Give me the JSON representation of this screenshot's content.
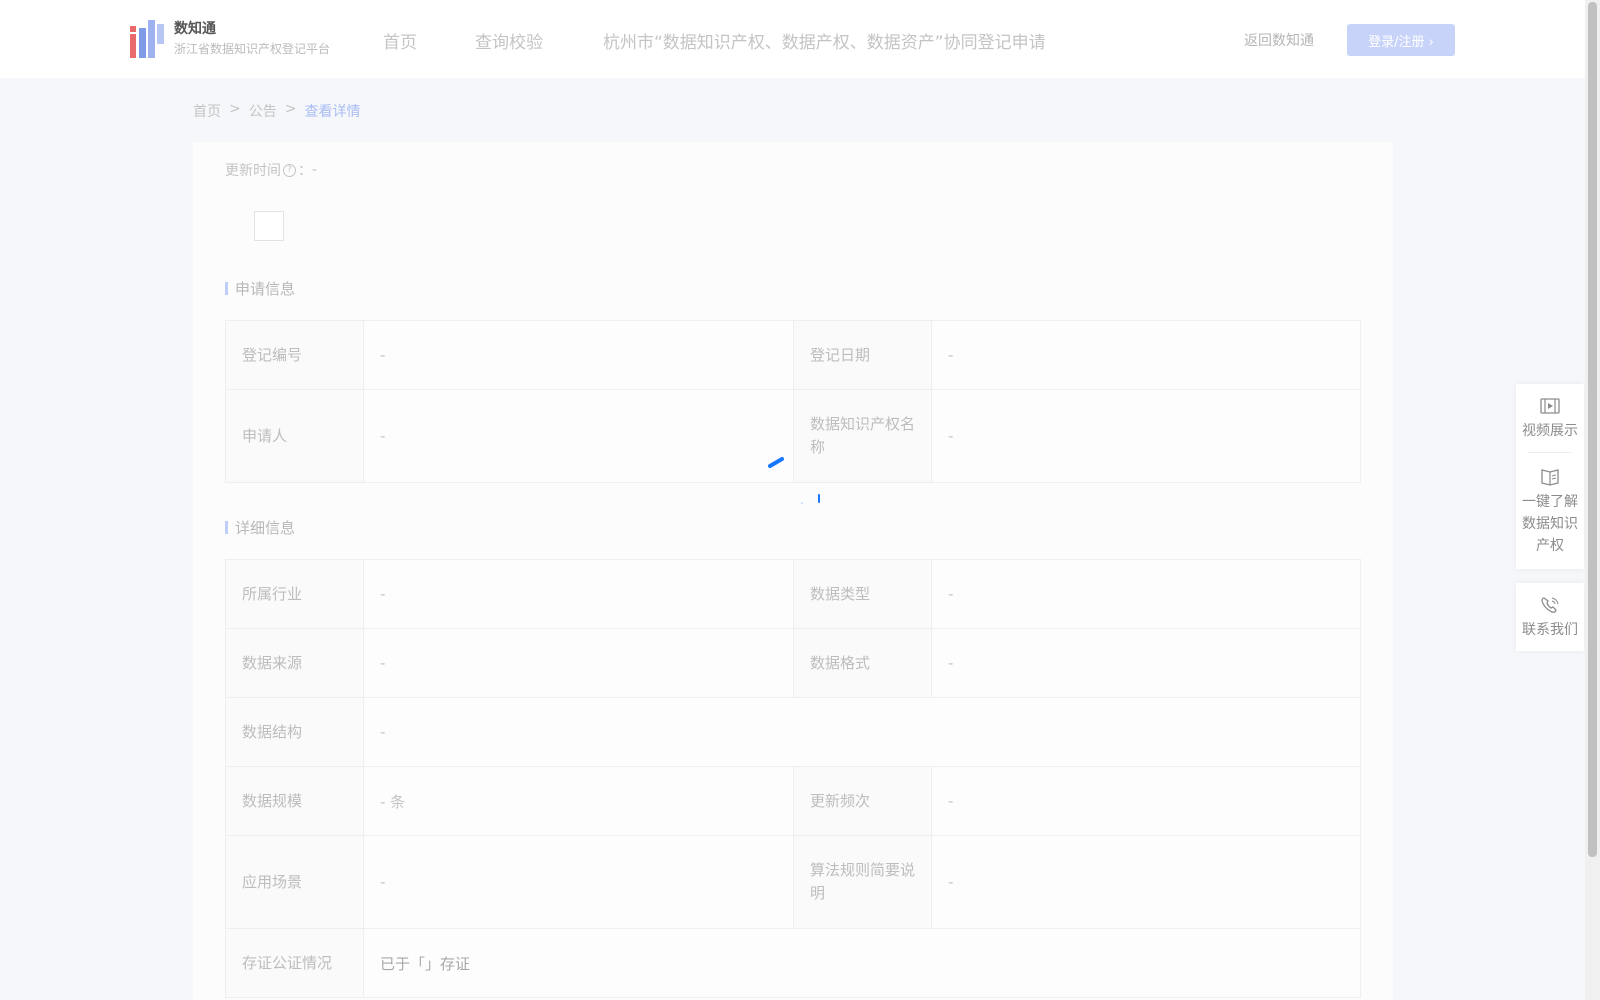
{
  "header": {
    "logo_title": "数知通",
    "logo_subtitle": "浙江省数据知识产权登记平台",
    "nav": [
      "首页",
      "查询校验",
      "杭州市“数据知识产权、数据产权、数据资产”协同登记申请"
    ],
    "return_link": "返回数知通",
    "login_label": "登录/注册 ›"
  },
  "breadcrumb": {
    "home": "首页",
    "sep1": ">",
    "notice": "公告",
    "sep2": ">",
    "current": "查看详情"
  },
  "update_time": {
    "label": "更新时间",
    "help": "?",
    "colon": "：",
    "value": "-"
  },
  "sections": {
    "apply_title": "申请信息",
    "detail_title": "详细信息"
  },
  "apply_info": {
    "reg_no_label": "登记编号",
    "reg_no_value": "-",
    "reg_date_label": "登记日期",
    "reg_date_value": "-",
    "applicant_label": "申请人",
    "applicant_value": "-",
    "ip_name_label": "数据知识产权名称",
    "ip_name_value": "-"
  },
  "detail_info": {
    "industry_label": "所属行业",
    "industry_value": "-",
    "data_type_label": "数据类型",
    "data_type_value": "-",
    "source_label": "数据来源",
    "source_value": "-",
    "format_label": "数据格式",
    "format_value": "-",
    "structure_label": "数据结构",
    "structure_value": "-",
    "scale_label": "数据规模",
    "scale_value": "- 条",
    "frequency_label": "更新频次",
    "frequency_value": "-",
    "scenario_label": "应用场景",
    "scenario_value": "-",
    "algorithm_label": "算法规则简要说明",
    "algorithm_value": "-",
    "notary_label": "存证公证情况",
    "notary_value": "已于「」存证"
  },
  "float_bar": {
    "video": "视频展示",
    "learn": "一键了解数据知识产权",
    "contact": "联系我们"
  },
  "colors": {
    "accent": "#1677ff",
    "accent_faded": "#c8d3fa"
  }
}
